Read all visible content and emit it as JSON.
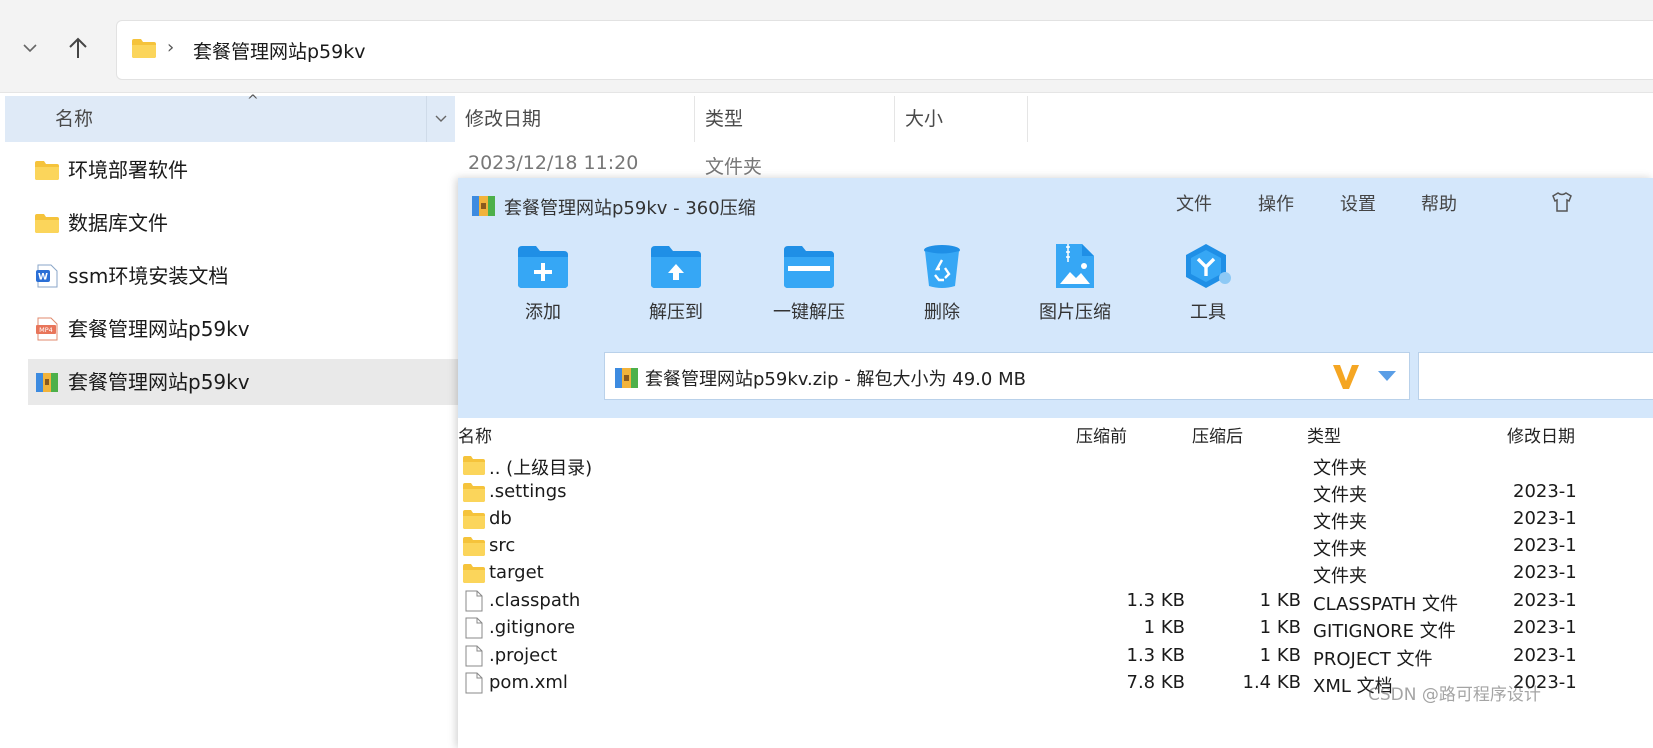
{
  "explorer": {
    "address_segment": "套餐管理网站p59kv",
    "columns": {
      "name": "名称",
      "date": "修改日期",
      "type": "类型",
      "size": "大小"
    },
    "files": [
      {
        "name": "环境部署软件",
        "icon": "folder-icon"
      },
      {
        "name": "数据库文件",
        "icon": "folder-icon"
      },
      {
        "name": "ssm环境安装文档",
        "icon": "word-doc-icon"
      },
      {
        "name": "套餐管理网站p59kv",
        "icon": "mp4-file-icon"
      },
      {
        "name": "套餐管理网站p59kv",
        "icon": "zip-archive-icon",
        "selected": true
      }
    ],
    "first_row_date": "2023/12/18 11:20",
    "first_row_type": "文件夹"
  },
  "zip": {
    "title": "套餐管理网站p59kv - 360压缩",
    "menu": [
      "文件",
      "操作",
      "设置",
      "帮助"
    ],
    "tools": [
      {
        "label": "添加",
        "icon": "add-icon"
      },
      {
        "label": "解压到",
        "icon": "extract-to-icon"
      },
      {
        "label": "一键解压",
        "icon": "one-click-extract-icon"
      },
      {
        "label": "删除",
        "icon": "delete-icon"
      },
      {
        "label": "图片压缩",
        "icon": "image-compress-icon"
      },
      {
        "label": "工具",
        "icon": "tools-icon"
      }
    ],
    "path": "套餐管理网站p59kv.zip - 解包大小为 49.0 MB",
    "columns": {
      "name": "名称",
      "before": "压缩前",
      "after": "压缩后",
      "type": "类型",
      "modified": "修改日期"
    },
    "rows": [
      {
        "name": ".. (上级目录)",
        "before": "",
        "after": "",
        "type": "文件夹",
        "modified": "",
        "icon": "folder-icon"
      },
      {
        "name": ".settings",
        "before": "",
        "after": "",
        "type": "文件夹",
        "modified": "2023-1",
        "icon": "folder-icon"
      },
      {
        "name": "db",
        "before": "",
        "after": "",
        "type": "文件夹",
        "modified": "2023-1",
        "icon": "folder-icon"
      },
      {
        "name": "src",
        "before": "",
        "after": "",
        "type": "文件夹",
        "modified": "2023-1",
        "icon": "folder-icon"
      },
      {
        "name": "target",
        "before": "",
        "after": "",
        "type": "文件夹",
        "modified": "2023-1",
        "icon": "folder-icon"
      },
      {
        "name": ".classpath",
        "before": "1.3 KB",
        "after": "1 KB",
        "type": "CLASSPATH 文件",
        "modified": "2023-1",
        "icon": "file-icon"
      },
      {
        "name": ".gitignore",
        "before": "1 KB",
        "after": "1 KB",
        "type": "GITIGNORE 文件",
        "modified": "2023-1",
        "icon": "file-icon"
      },
      {
        "name": ".project",
        "before": "1.3 KB",
        "after": "1 KB",
        "type": "PROJECT 文件",
        "modified": "2023-1",
        "icon": "file-icon"
      },
      {
        "name": "pom.xml",
        "before": "7.8 KB",
        "after": "1.4 KB",
        "type": "XML 文档",
        "modified": "2023-1",
        "icon": "file-icon"
      }
    ]
  },
  "watermark": "CSDN @路可程序设计",
  "colors": {
    "accent_blue": "#2a8ad8",
    "zip_window_bg": "#d4e7fb",
    "folder_yellow": "#f5c33b",
    "selected_header_bg": "#dfeaf7"
  }
}
